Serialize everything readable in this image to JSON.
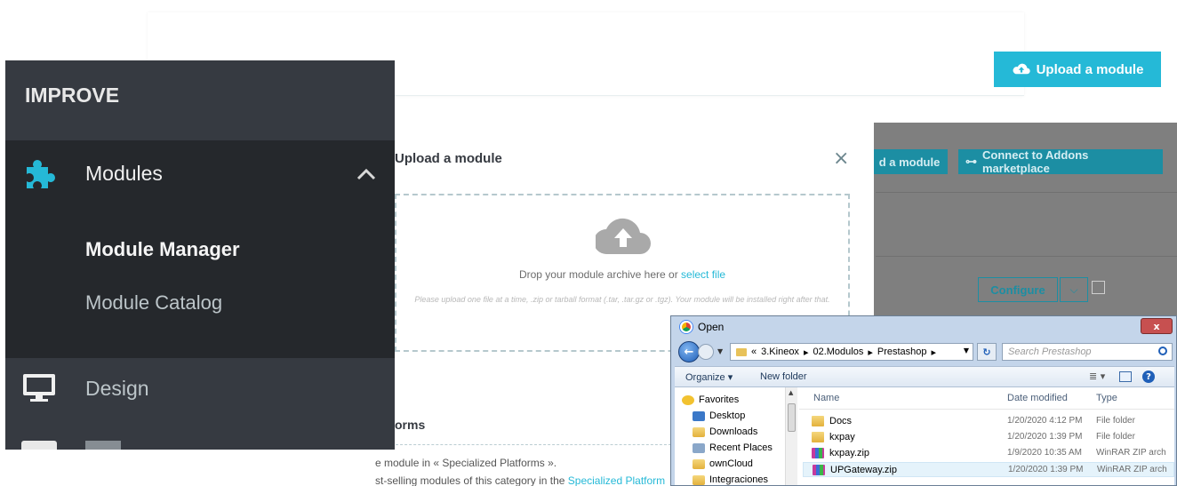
{
  "top": {
    "upload_button": "Upload a module"
  },
  "background": {
    "upload_button_partial": "d a module",
    "connect_button": "Connect to Addons marketplace",
    "configure_button": "Configure",
    "section_title": "orms",
    "text_line1": "e module in « Specialized Platforms ».",
    "text_line2_prefix": "st-selling modules of this category in the ",
    "text_line2_link": "Specialized Platform"
  },
  "modal": {
    "title": "Upload a module",
    "close_glyph": "×",
    "drop_text": "Drop your module archive here or ",
    "drop_link": "select file",
    "hint": "Please upload one file at a time, .zip or tarball format (.tar, .tar.gz or .tgz). Your module will be installed right after that."
  },
  "sidebar": {
    "heading": "IMPROVE",
    "modules": "Modules",
    "sub_items": [
      "Module Manager",
      "Module Catalog"
    ],
    "design": "Design"
  },
  "dialog": {
    "title": "Open",
    "close_glyph": "x",
    "path": [
      "«",
      "3.Kineox",
      "▸",
      "02.Modulos",
      "▸",
      "Prestashop",
      "▸"
    ],
    "search_placeholder": "Search Prestashop",
    "organize": "Organize ▾",
    "new_folder": "New folder",
    "favorites": [
      "Favorites",
      "Desktop",
      "Downloads",
      "Recent Places",
      "ownCloud",
      "Integraciones"
    ],
    "columns": {
      "name": "Name",
      "date": "Date modified",
      "type": "Type"
    },
    "files": [
      {
        "name": "Docs",
        "date": "1/20/2020 4:12 PM",
        "type": "File folder",
        "kind": "folder"
      },
      {
        "name": "kxpay",
        "date": "1/20/2020 1:39 PM",
        "type": "File folder",
        "kind": "folder"
      },
      {
        "name": "kxpay.zip",
        "date": "1/9/2020 10:35 AM",
        "type": "WinRAR ZIP arch",
        "kind": "zip"
      },
      {
        "name": "UPGateway.zip",
        "date": "1/20/2020 1:39 PM",
        "type": "WinRAR ZIP arch",
        "kind": "zip"
      }
    ]
  },
  "colors": {
    "accent": "#25b9d7",
    "sidebar_bg": "#363a41",
    "sidebar_active_bg": "#25282c",
    "puzzle_icon": "#25b9d7"
  }
}
